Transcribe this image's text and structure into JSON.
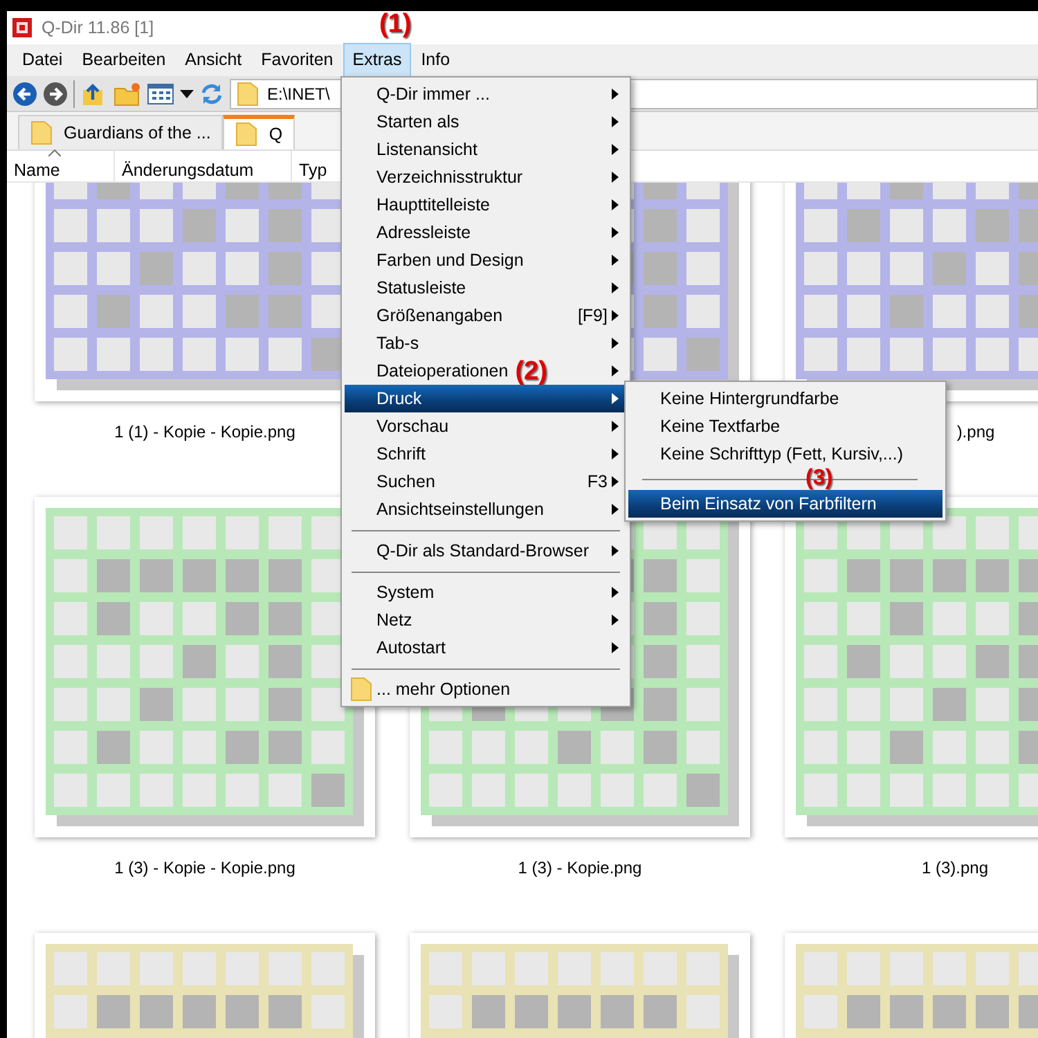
{
  "window": {
    "title": "Q-Dir 11.86 [1]"
  },
  "menubar": [
    {
      "label": "Datei",
      "selected": false
    },
    {
      "label": "Bearbeiten",
      "selected": false
    },
    {
      "label": "Ansicht",
      "selected": false
    },
    {
      "label": "Favoriten",
      "selected": false
    },
    {
      "label": "Extras",
      "selected": true
    },
    {
      "label": "Info",
      "selected": false
    }
  ],
  "toolbar": {
    "address": "E:\\INET\\"
  },
  "tabs": [
    {
      "label": "Guardians of the ...",
      "selected": false
    },
    {
      "label": "Q",
      "selected": true
    }
  ],
  "columns": [
    {
      "label": "Name",
      "sorted": true
    },
    {
      "label": "Änderungsdatum",
      "sorted": false
    },
    {
      "label": "Typ",
      "sorted": false
    }
  ],
  "files": [
    {
      "label": "1 (1) - Kopie - Kopie.png",
      "color": "#b4b4e8"
    },
    {
      "color": "#b4b4e8"
    },
    {
      "label": ").png",
      "color": "#b4b4e8"
    },
    {
      "label": "1 (3) - Kopie - Kopie.png",
      "color": "#b8e8b8"
    },
    {
      "label": "1 (3) - Kopie.png",
      "color": "#b8e8b8"
    },
    {
      "label": "1 (3).png",
      "color": "#b8e8b8"
    },
    {
      "color": "#e8e2b4"
    },
    {
      "color": "#e8e2b4"
    },
    {
      "color": "#e8e2b4"
    }
  ],
  "extras_menu": [
    {
      "kind": "item",
      "label": "Q-Dir immer ...",
      "selected": false
    },
    {
      "kind": "item",
      "label": "Starten als",
      "selected": false
    },
    {
      "kind": "item",
      "label": "Listenansicht",
      "selected": false
    },
    {
      "kind": "item",
      "label": "Verzeichnisstruktur",
      "selected": false
    },
    {
      "kind": "item",
      "label": "Haupttitelleiste",
      "selected": false
    },
    {
      "kind": "item",
      "label": "Adressleiste",
      "selected": false
    },
    {
      "kind": "item",
      "label": "Farben und Design",
      "selected": false
    },
    {
      "kind": "item",
      "label": "Statusleiste",
      "selected": false
    },
    {
      "kind": "item",
      "label": "Größenangaben",
      "shortcut": "[F9]",
      "selected": false
    },
    {
      "kind": "item",
      "label": "Tab-s",
      "selected": false
    },
    {
      "kind": "item",
      "label": "Dateioperationen",
      "selected": false
    },
    {
      "kind": "item",
      "label": "Druck",
      "selected": true
    },
    {
      "kind": "item",
      "label": "Vorschau",
      "selected": false
    },
    {
      "kind": "item",
      "label": "Schrift",
      "selected": false
    },
    {
      "kind": "item",
      "label": "Suchen",
      "shortcut": "F3",
      "selected": false
    },
    {
      "kind": "item",
      "label": "Ansichtseinstellungen",
      "selected": false
    },
    {
      "kind": "separator"
    },
    {
      "kind": "item",
      "label": "Q-Dir als Standard-Browser",
      "selected": false
    },
    {
      "kind": "separator"
    },
    {
      "kind": "item",
      "label": "System",
      "selected": false
    },
    {
      "kind": "item",
      "label": "Netz",
      "selected": false
    },
    {
      "kind": "item",
      "label": "Autostart",
      "selected": false
    },
    {
      "kind": "separator"
    },
    {
      "kind": "folder",
      "label": "... mehr Optionen",
      "selected": false
    }
  ],
  "druck_submenu": [
    {
      "kind": "plain",
      "label": "Keine Hintergrundfarbe",
      "selected": false
    },
    {
      "kind": "plain",
      "label": "Keine Textfarbe",
      "selected": false
    },
    {
      "kind": "plain",
      "label": "Keine Schrifttyp (Fett, Kursiv,...)",
      "selected": false
    },
    {
      "kind": "separator"
    },
    {
      "kind": "plain",
      "label": "Beim Einsatz von Farbfiltern",
      "selected": true
    }
  ],
  "annotations": [
    {
      "label": "(1)"
    },
    {
      "label": "(2)"
    },
    {
      "label": "(3)"
    }
  ]
}
